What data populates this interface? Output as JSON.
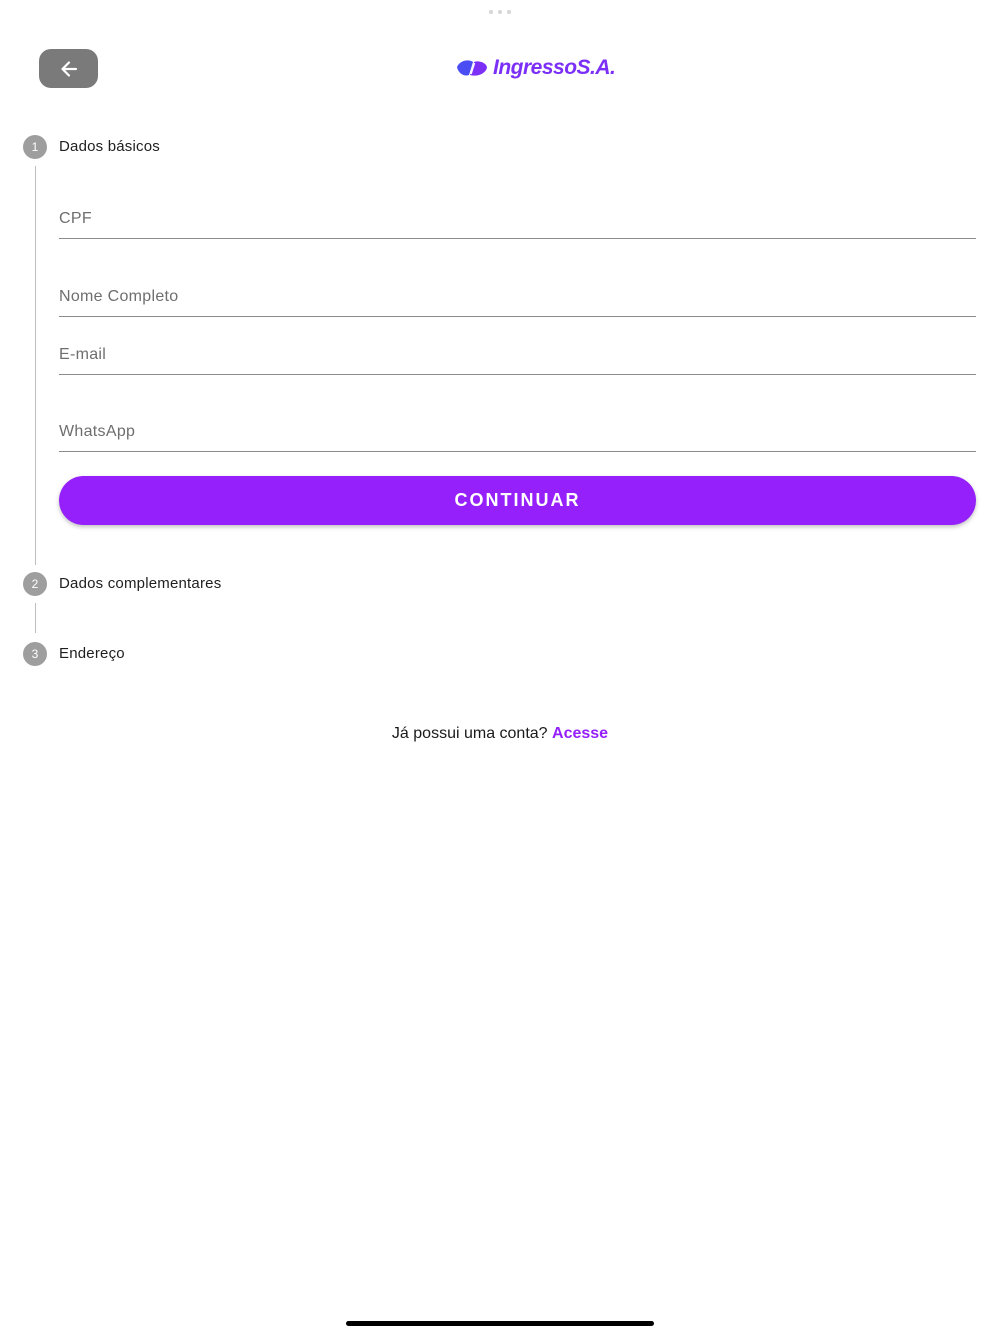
{
  "header": {
    "logo_text": "IngressoS.A.",
    "back_icon": "arrow-left-icon"
  },
  "colors": {
    "accent": "#9520fb",
    "logo_blue": "#4a4ef2",
    "logo_purple": "#7b2ff7",
    "back_button_bg": "#7a7a7a",
    "step_circle": "#9e9e9e"
  },
  "steps": [
    {
      "number": "1",
      "label": "Dados básicos"
    },
    {
      "number": "2",
      "label": "Dados complementares"
    },
    {
      "number": "3",
      "label": "Endereço"
    }
  ],
  "form": {
    "cpf_placeholder": "CPF",
    "name_placeholder": "Nome Completo",
    "email_placeholder": "E-mail",
    "whatsapp_placeholder": "WhatsApp",
    "continue_label": "CONTINUAR"
  },
  "footer": {
    "prompt_text": "Já possui uma conta?",
    "login_link": "Acesse"
  }
}
